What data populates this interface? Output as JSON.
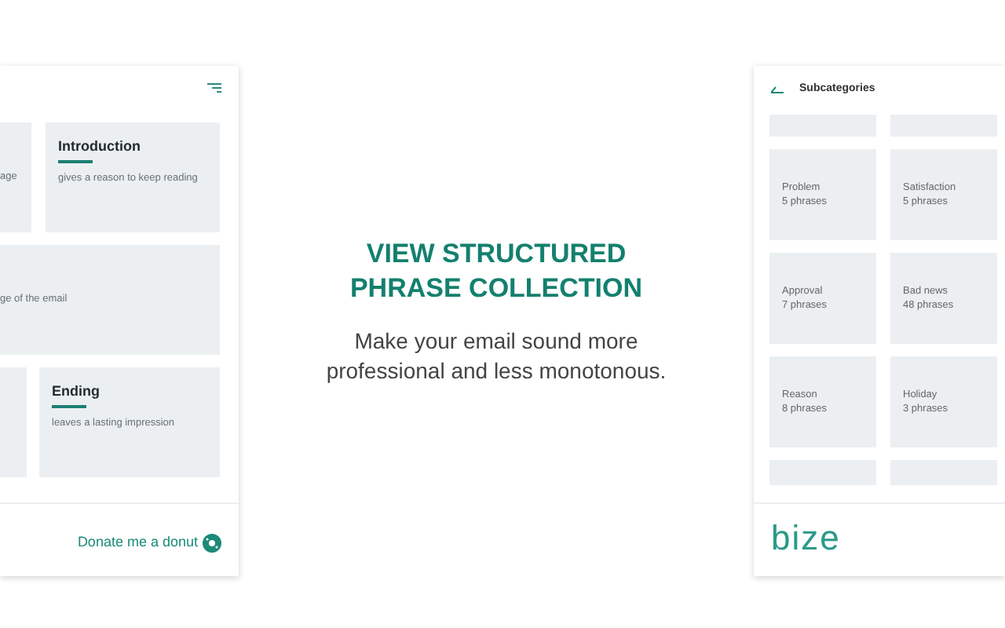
{
  "left_panel": {
    "card_rows": [
      [
        {
          "description": "age"
        },
        {
          "title": "Introduction",
          "description": "gives a reason to keep reading"
        }
      ],
      [
        {
          "description": "ge of the email"
        }
      ],
      [
        {},
        {
          "title": "Ending",
          "description": "leaves a lasting impression"
        }
      ]
    ],
    "donate_link": "Donate me a donut"
  },
  "center": {
    "headline": [
      "VIEW STRUCTURED",
      "PHRASE COLLECTION"
    ],
    "subtitle": [
      "Make your email sound more",
      "professional and less monotonous."
    ]
  },
  "right_panel": {
    "title": "Subcategories",
    "subcategories": [
      {
        "name": "Problem",
        "count": "5 phrases"
      },
      {
        "name": "Satisfaction",
        "count": "5 phrases"
      },
      {
        "name": "Approval",
        "count": "7 phrases"
      },
      {
        "name": "Bad news",
        "count": "48 phrases"
      },
      {
        "name": "Reason",
        "count": "8 phrases"
      },
      {
        "name": "Holiday",
        "count": "3 phrases"
      }
    ],
    "logo": "bize"
  }
}
